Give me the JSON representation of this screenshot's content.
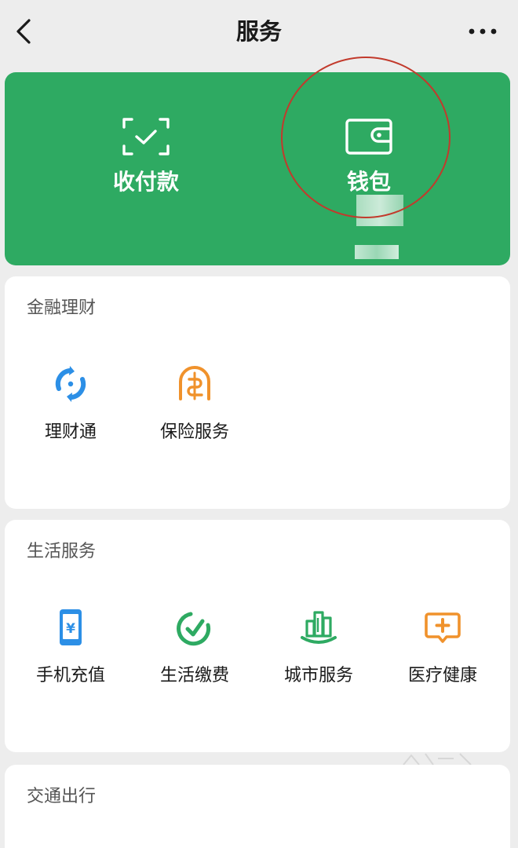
{
  "header": {
    "title": "服务",
    "back_icon": "chevron-left-icon",
    "more_icon": "more-horizontal-icon"
  },
  "wallet_card": {
    "color": "#2eaa62",
    "items": [
      {
        "label": "收付款",
        "icon": "scan-pay-icon"
      },
      {
        "label": "钱包",
        "icon": "wallet-icon"
      }
    ],
    "annotation_color": "#c23a2c"
  },
  "sections": [
    {
      "title": "金融理财",
      "items": [
        {
          "label": "理财通",
          "icon": "licaitong-icon",
          "color": "#2c8fe6"
        },
        {
          "label": "保险服务",
          "icon": "insurance-icon",
          "color": "#f0922c"
        }
      ]
    },
    {
      "title": "生活服务",
      "items": [
        {
          "label": "手机充值",
          "icon": "phone-recharge-icon",
          "color": "#2c8fe6"
        },
        {
          "label": "生活缴费",
          "icon": "bill-pay-icon",
          "color": "#2eaa62"
        },
        {
          "label": "城市服务",
          "icon": "city-service-icon",
          "color": "#2eaa62"
        },
        {
          "label": "医疗健康",
          "icon": "medical-icon",
          "color": "#f0922c"
        }
      ]
    },
    {
      "title": "交通出行",
      "items": []
    }
  ]
}
